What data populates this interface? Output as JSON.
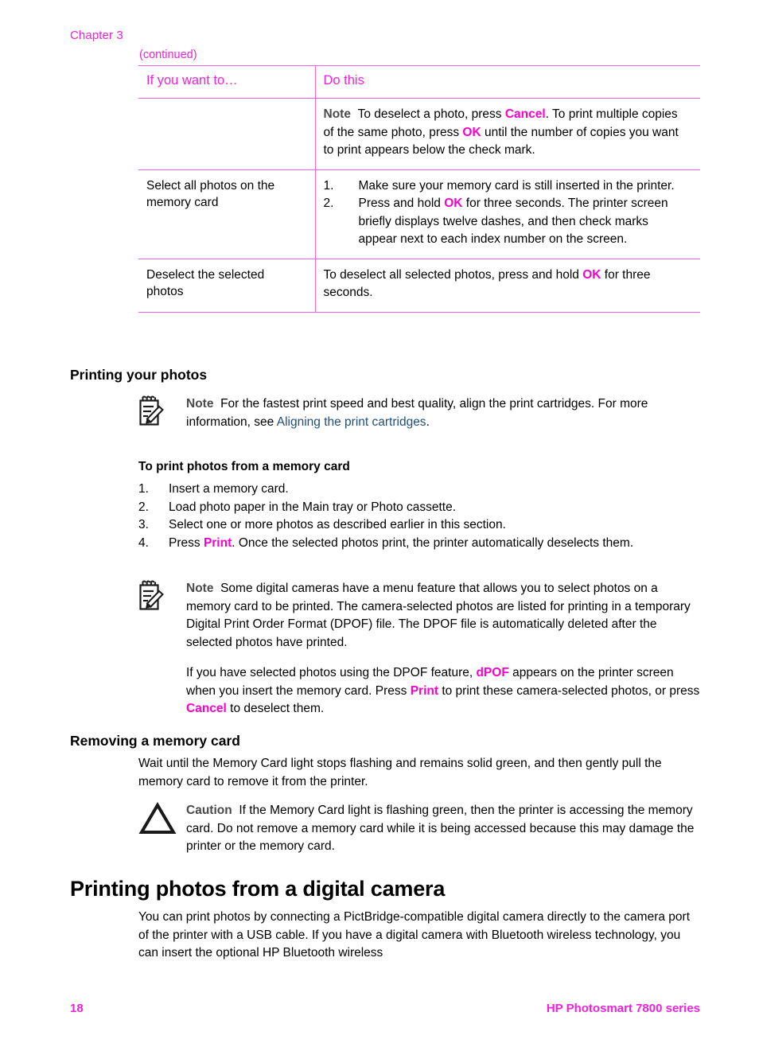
{
  "header": {
    "chapter": "Chapter 3",
    "continued": "(continued)"
  },
  "table": {
    "columns": [
      "If you want to…",
      "Do this"
    ],
    "rows": [
      {
        "label": "",
        "note_label": "Note",
        "note_text_1": "To deselect a photo, press ",
        "kw1": "Cancel",
        "note_text_2": ". To print multiple copies of the same photo, press ",
        "kw2": "OK",
        "note_text_3": " until the number of copies you want to print appears below the check mark."
      },
      {
        "label": "Select all photos on the memory card",
        "steps": [
          {
            "num": "1.",
            "text": "Make sure your memory card is still inserted in the printer."
          },
          {
            "num": "2.",
            "pre": "Press and hold ",
            "kw": "OK",
            "post": " for three seconds. The printer screen briefly displays twelve dashes, and then check marks appear next to each index number on the screen."
          }
        ]
      },
      {
        "label": "Deselect the selected photos",
        "pre": "To deselect all selected photos, press and hold ",
        "kw": "OK",
        "post": " for three seconds."
      }
    ]
  },
  "printing_your_photos": {
    "heading": "Printing your photos",
    "note": {
      "icon": "note-pad-pencil-icon",
      "label": "Note",
      "text_1": "For the fastest print speed and best quality, align the print cartridges. For more information, see ",
      "link": "Aligning the print cartridges",
      "text_2": "."
    },
    "subheading": "To print photos from a memory card",
    "steps": [
      {
        "num": "1.",
        "text": "Insert a memory card."
      },
      {
        "num": "2.",
        "text": "Load photo paper in the Main tray or Photo cassette."
      },
      {
        "num": "3.",
        "text": "Select one or more photos as described earlier in this section."
      },
      {
        "num": "4.",
        "pre": "Press ",
        "kw": "Print",
        "post": ". Once the selected photos print, the printer automatically deselects them."
      }
    ],
    "note2": {
      "icon": "note-pad-pencil-icon",
      "label": "Note",
      "paragraph1": "Some digital cameras have a menu feature that allows you to select photos on a memory card to be printed. The camera-selected photos are listed for printing in a temporary Digital Print Order Format (DPOF) file. The DPOF file is automatically deleted after the selected photos have printed.",
      "p2_a": "If you have selected photos using the DPOF feature, ",
      "p2_kw1": "dPOF",
      "p2_b": " appears on the printer screen when you insert the memory card. Press ",
      "p2_kw2": "Print",
      "p2_c": " to print these camera-selected photos, or press ",
      "p2_kw3": "Cancel",
      "p2_d": " to deselect them."
    }
  },
  "removing_memory_card": {
    "heading": "Removing a memory card",
    "paragraph": "Wait until the Memory Card light stops flashing and remains solid green, and then gently pull the memory card to remove it from the printer.",
    "caution": {
      "icon": "warning-triangle-icon",
      "label": "Caution",
      "text": "If the Memory Card light is flashing green, then the printer is accessing the memory card. Do not remove a memory card while it is being accessed because this may damage the printer or the memory card."
    }
  },
  "digital_camera_section": {
    "heading": "Printing photos from a digital camera",
    "paragraph": "You can print photos by connecting a PictBridge-compatible digital camera directly to the camera port of the printer with a USB cable. If you have a digital camera with Bluetooth wireless technology, you can insert the optional HP Bluetooth wireless"
  },
  "footer": {
    "page_number": "18",
    "product": "HP Photosmart 7800 series"
  },
  "colors": {
    "magenta": "#ee22dd",
    "keyword_pink": "#ff00cc",
    "rule_pink": "#f060e8",
    "link_blue": "#1f4e79",
    "note_label_gray": "#4a4a4a"
  }
}
